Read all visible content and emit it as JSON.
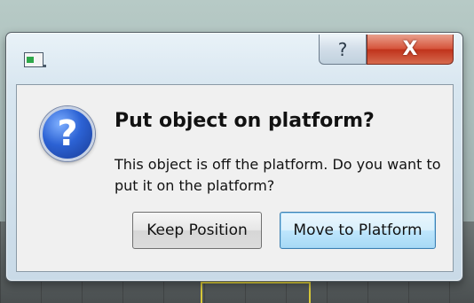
{
  "window": {
    "help_label": "?",
    "close_label": "X",
    "app_icon": "window-app-icon"
  },
  "dialog": {
    "icon": "question-icon",
    "icon_glyph": "?",
    "title": "Put object on platform?",
    "message": "This object is off the platform. Do you want to put it on the platform?",
    "buttons": {
      "keep": "Keep Position",
      "move": "Move to Platform"
    }
  },
  "colors": {
    "close_button": "#c0331c",
    "default_button_border": "#3c7fb1",
    "question_icon": "#2c62d4"
  }
}
